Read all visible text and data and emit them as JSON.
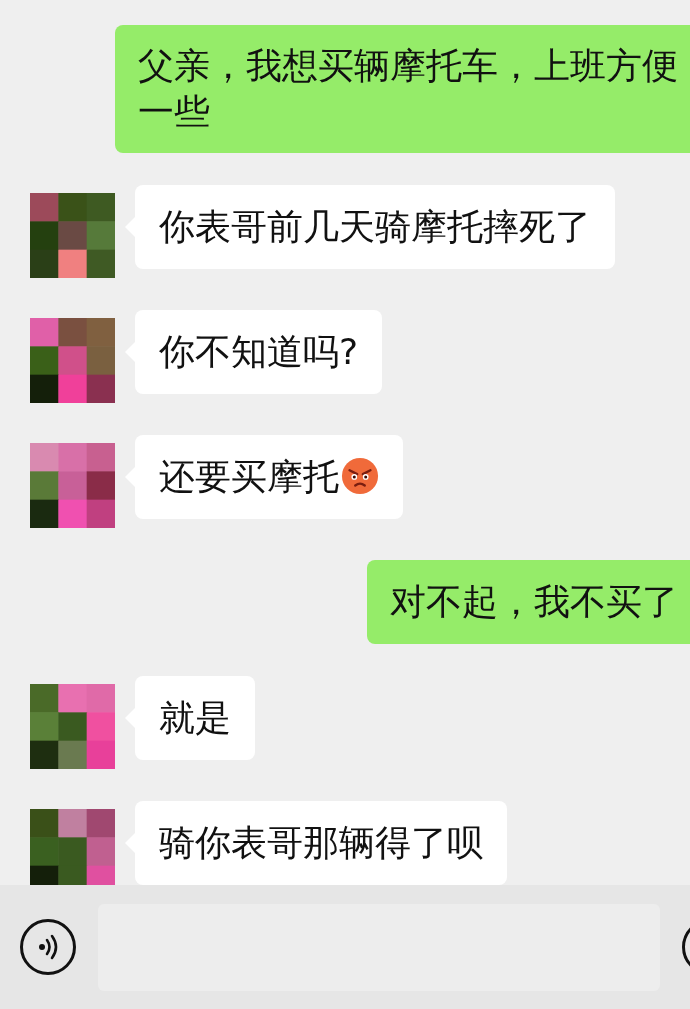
{
  "messages": [
    {
      "kind": "sent",
      "text": "父亲，我想买辆摩托车，上班方便一些"
    },
    {
      "kind": "received",
      "text": "你表哥前几天骑摩托摔死了"
    },
    {
      "kind": "received",
      "text": "你不知道吗?"
    },
    {
      "kind": "received",
      "text": "还要买摩托",
      "trailing_icon": {
        "kind": "angry"
      }
    },
    {
      "kind": "sent",
      "text": "对不起，我不买了"
    },
    {
      "kind": "received",
      "text": "就是"
    },
    {
      "kind": "received",
      "text": "骑你表哥那辆得了呗"
    }
  ]
}
